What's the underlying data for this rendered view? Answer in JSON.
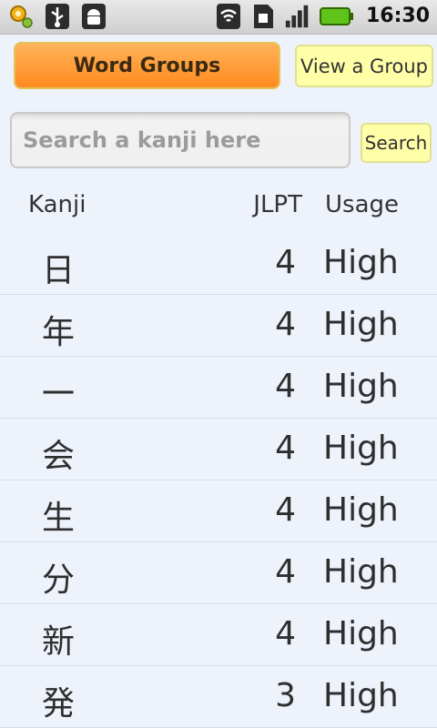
{
  "status_bar": {
    "time": "16:30",
    "icons": [
      "settings-gear-icon",
      "usb-icon",
      "android-debug-icon",
      "wifi-icon",
      "sim-card-icon",
      "signal-icon",
      "battery-icon"
    ]
  },
  "toolbar": {
    "word_groups_label": "Word Groups",
    "view_group_label": "View a Group"
  },
  "search": {
    "placeholder": "Search a kanji here",
    "button_label": "Search"
  },
  "table": {
    "headers": {
      "kanji": "Kanji",
      "jlpt": "JLPT",
      "usage": "Usage"
    },
    "rows": [
      {
        "kanji": "日",
        "jlpt": "4",
        "usage": "High"
      },
      {
        "kanji": "年",
        "jlpt": "4",
        "usage": "High"
      },
      {
        "kanji": "一",
        "jlpt": "4",
        "usage": "High"
      },
      {
        "kanji": "会",
        "jlpt": "4",
        "usage": "High"
      },
      {
        "kanji": "生",
        "jlpt": "4",
        "usage": "High"
      },
      {
        "kanji": "分",
        "jlpt": "4",
        "usage": "High"
      },
      {
        "kanji": "新",
        "jlpt": "4",
        "usage": "High"
      },
      {
        "kanji": "発",
        "jlpt": "3",
        "usage": "High"
      }
    ]
  },
  "colors": {
    "background": "#eef3fb",
    "word_groups_button": "#ff9a32",
    "secondary_button": "#ffffa8",
    "battery": "#5fc31a"
  }
}
